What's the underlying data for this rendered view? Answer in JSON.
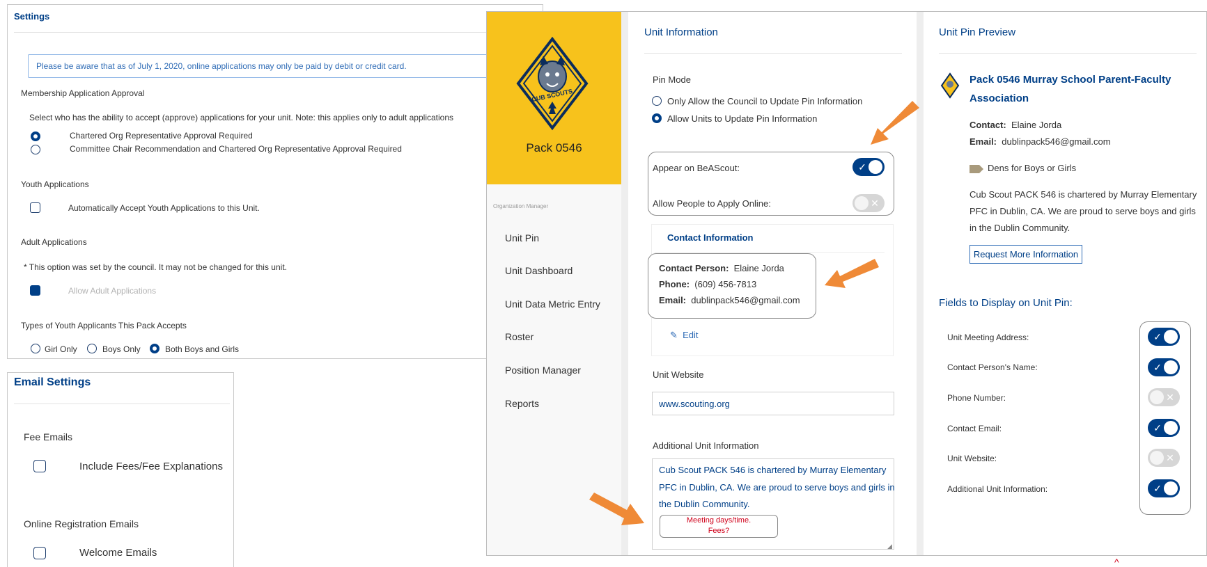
{
  "settings": {
    "title": "Settings",
    "notice": "Please be aware that as of July 1, 2020, online applications may only be paid by debit or credit card.",
    "membership": {
      "heading": "Membership Application Approval",
      "description": "Select who has the ability to accept (approve) applications for your unit. Note: this applies only to adult applications",
      "options": [
        "Chartered Org Representative Approval Required",
        "Committee Chair Recommendation and Chartered Org Representative Approval Required"
      ]
    },
    "youth": {
      "heading": "Youth Applications",
      "option": "Automatically Accept Youth Applications to this Unit."
    },
    "adult": {
      "heading": "Adult Applications",
      "note": "* This option was set by the council. It may not be changed for this unit.",
      "option": "Allow Adult Applications"
    },
    "types": {
      "heading": "Types of Youth Applicants This Pack Accepts",
      "options": [
        "Girl Only",
        "Boys Only",
        "Both Boys and Girls"
      ]
    }
  },
  "email_settings": {
    "title": "Email Settings",
    "fee_heading": "Fee Emails",
    "fee_option": "Include Fees/Fee Explanations",
    "online_heading": "Online Registration Emails",
    "online_option": "Welcome Emails"
  },
  "unit": {
    "name": "Pack 0546",
    "logo_text": "CUB SCOUTS",
    "sidebar_caption": "Organization Manager",
    "sidebar_items": [
      "Unit Pin",
      "Unit Dashboard",
      "Unit Data Metric Entry",
      "Roster",
      "Position Manager",
      "Reports"
    ]
  },
  "unit_info": {
    "title": "Unit Information",
    "pin_mode_label": "Pin Mode",
    "pin_mode_options": [
      "Only Allow the Council to Update Pin Information",
      "Allow Units to Update Pin Information"
    ],
    "appear_label": "Appear on BeAScout:",
    "apply_label": "Allow People to Apply Online:",
    "contact_title": "Contact Information",
    "contact_person_label": "Contact Person:",
    "contact_person": "Elaine Jorda",
    "phone_label": "Phone:",
    "phone": "(609) 456-7813",
    "email_label": "Email:",
    "email": "dublinpack546@gmail.com",
    "edit_label": "Edit",
    "website_label": "Unit Website",
    "website": "www.scouting.org",
    "additional_label": "Additional Unit Information",
    "additional_lines": [
      "Cub Scout PACK 546 is chartered by Murray Elementary",
      "PFC in Dublin, CA. We are proud to serve boys and girls in",
      "the Dublin Community."
    ],
    "callout_lines": [
      "Meeting days/time.",
      "Fees?"
    ]
  },
  "pin_preview": {
    "title": "Unit Pin Preview",
    "name_lines": [
      "Pack 0546 Murray School Parent-Faculty",
      "Association"
    ],
    "contact_label": "Contact:",
    "contact": "Elaine Jorda",
    "email_label": "Email:",
    "email": "dublinpack546@gmail.com",
    "dens_tag": "Dens for Boys or Girls",
    "description_lines": [
      "Cub Scout PACK 546 is chartered by Murray Elementary",
      "PFC in Dublin, CA. We are proud to serve boys and girls",
      "in the Dublin Community."
    ],
    "request_button": "Request More Information",
    "fields_title": "Fields to Display on Unit Pin:",
    "fields": [
      {
        "label": "Unit Meeting Address:",
        "on": true
      },
      {
        "label": "Contact Person's Name:",
        "on": true
      },
      {
        "label": "Phone Number:",
        "on": false
      },
      {
        "label": "Contact Email:",
        "on": true
      },
      {
        "label": "Unit Website:",
        "on": false
      },
      {
        "label": "Additional Unit Information:",
        "on": true
      }
    ]
  },
  "colors": {
    "accent": "#003f87",
    "logo_bg": "#f7c21c",
    "arrow": "#ef8a37",
    "callout_text": "#d0021b"
  },
  "icons": [
    "check-icon",
    "x-icon",
    "tag-icon",
    "pencil-icon",
    "cub-scouts-logo"
  ]
}
